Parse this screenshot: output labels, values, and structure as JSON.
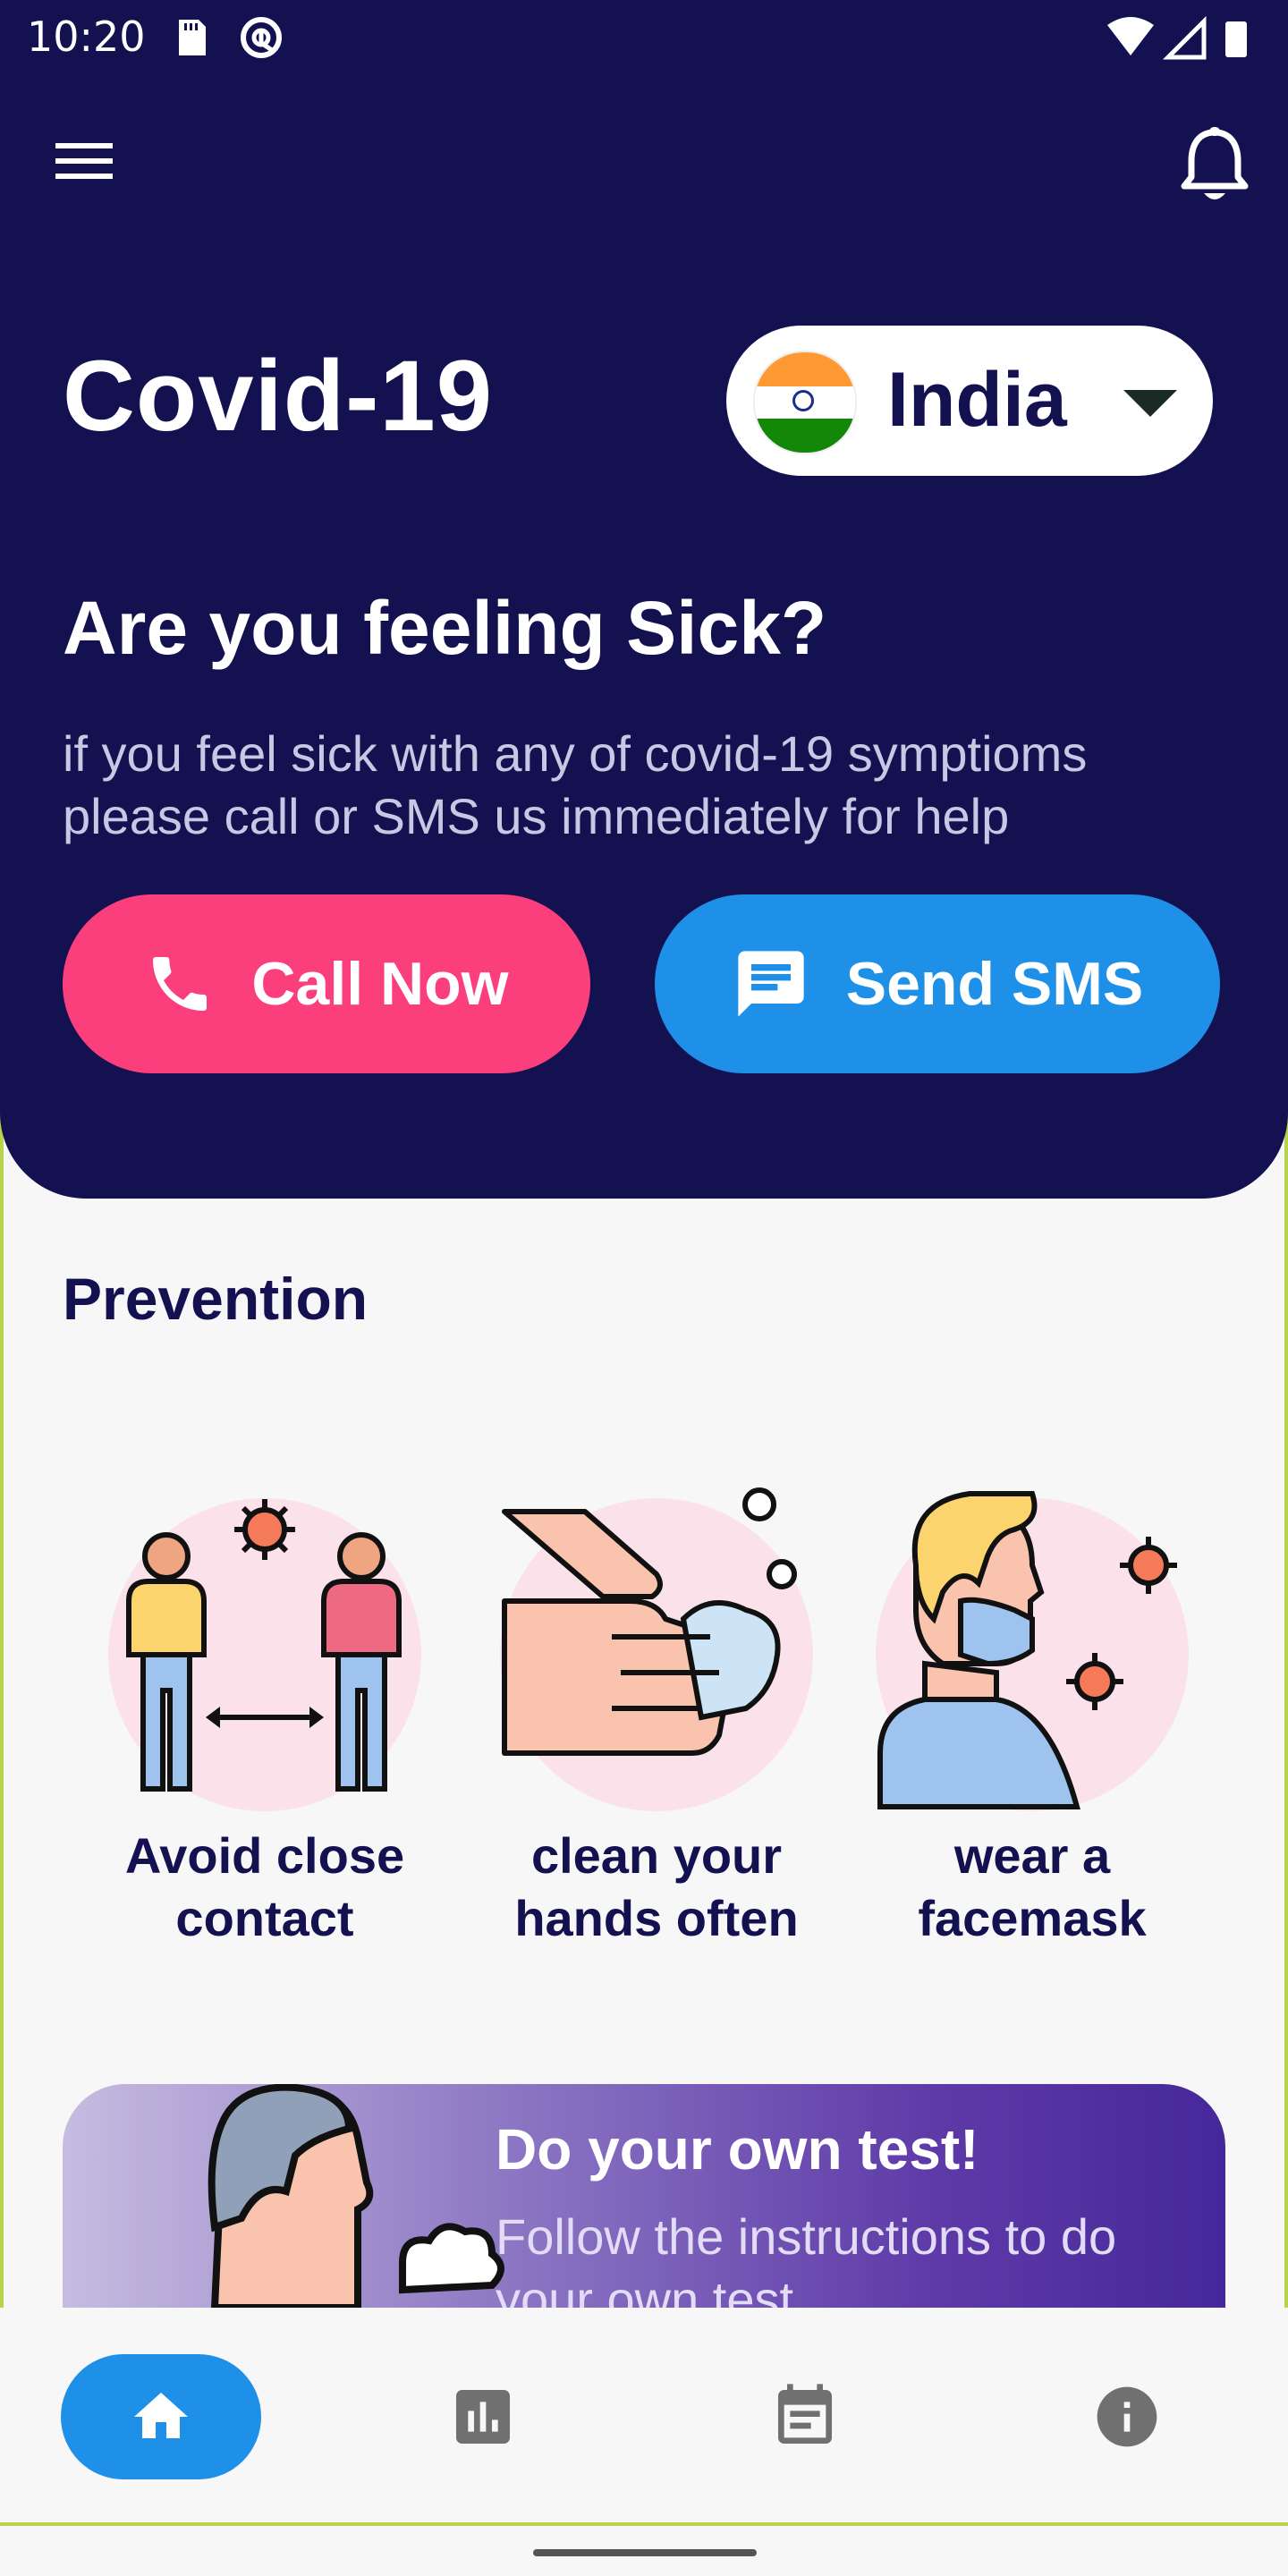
{
  "status_bar": {
    "time": "10:20"
  },
  "header": {
    "app_title": "Covid-19",
    "country": "India"
  },
  "sick_section": {
    "title": "Are you feeling Sick?",
    "description": "if you feel sick with any of covid-19 symptioms please call or SMS us immediately for help",
    "call_button": "Call Now",
    "sms_button": "Send SMS"
  },
  "prevention": {
    "title": "Prevention",
    "items": [
      {
        "line1": "Avoid close",
        "line2": "contact"
      },
      {
        "line1": "clean your",
        "line2": "hands often"
      },
      {
        "line1": "wear a",
        "line2": "facemask"
      }
    ]
  },
  "test_card": {
    "title": "Do your own test!",
    "description": "Follow the instructions to do your own test"
  },
  "colors": {
    "primary": "#131150",
    "call": "#fb3f7c",
    "sms": "#1e90e8"
  },
  "bottom_nav": {
    "items": [
      "home-icon",
      "stats-icon",
      "calendar-icon",
      "info-icon"
    ],
    "active": "home-icon"
  }
}
